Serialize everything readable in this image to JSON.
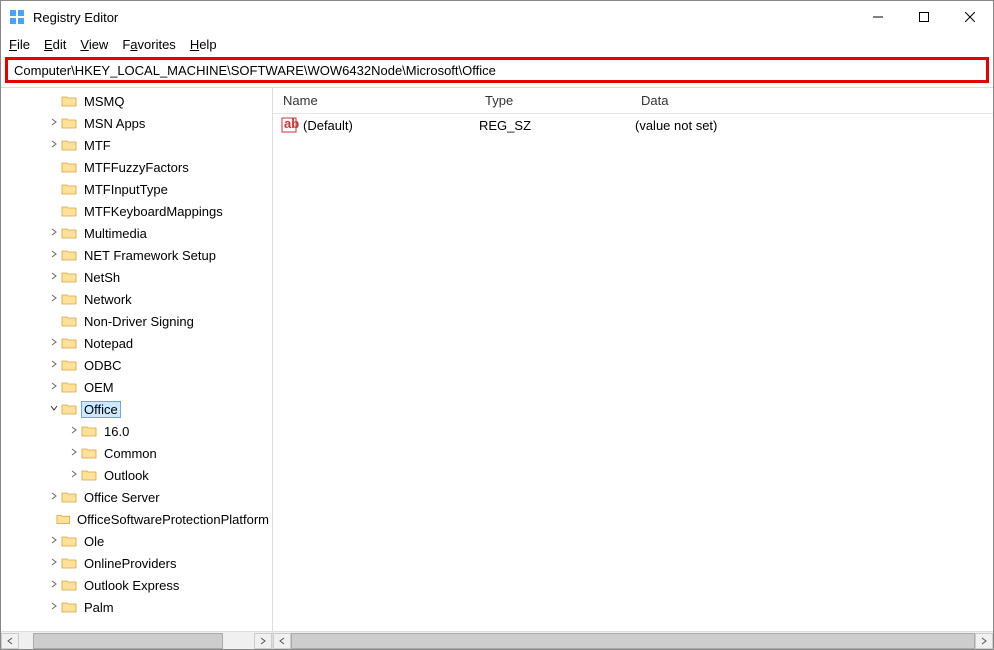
{
  "window": {
    "title": "Registry Editor"
  },
  "menu": {
    "file": "File",
    "edit": "Edit",
    "view": "View",
    "favorites": "Favorites",
    "help": "Help"
  },
  "address": {
    "path": "Computer\\HKEY_LOCAL_MACHINE\\SOFTWARE\\WOW6432Node\\Microsoft\\Office"
  },
  "columns": {
    "name": "Name",
    "type": "Type",
    "data": "Data"
  },
  "tree": [
    {
      "indent": 2,
      "exp": "",
      "label": "MSMQ"
    },
    {
      "indent": 2,
      "exp": ">",
      "label": "MSN Apps"
    },
    {
      "indent": 2,
      "exp": ">",
      "label": "MTF"
    },
    {
      "indent": 2,
      "exp": "",
      "label": "MTFFuzzyFactors"
    },
    {
      "indent": 2,
      "exp": "",
      "label": "MTFInputType"
    },
    {
      "indent": 2,
      "exp": "",
      "label": "MTFKeyboardMappings"
    },
    {
      "indent": 2,
      "exp": ">",
      "label": "Multimedia"
    },
    {
      "indent": 2,
      "exp": ">",
      "label": "NET Framework Setup"
    },
    {
      "indent": 2,
      "exp": ">",
      "label": "NetSh"
    },
    {
      "indent": 2,
      "exp": ">",
      "label": "Network"
    },
    {
      "indent": 2,
      "exp": "",
      "label": "Non-Driver Signing"
    },
    {
      "indent": 2,
      "exp": ">",
      "label": "Notepad"
    },
    {
      "indent": 2,
      "exp": ">",
      "label": "ODBC"
    },
    {
      "indent": 2,
      "exp": ">",
      "label": "OEM"
    },
    {
      "indent": 2,
      "exp": "v",
      "label": "Office",
      "selected": true
    },
    {
      "indent": 3,
      "exp": ">",
      "label": "16.0"
    },
    {
      "indent": 3,
      "exp": ">",
      "label": "Common"
    },
    {
      "indent": 3,
      "exp": ">",
      "label": "Outlook"
    },
    {
      "indent": 2,
      "exp": ">",
      "label": "Office Server"
    },
    {
      "indent": 2,
      "exp": "",
      "label": "OfficeSoftwareProtectionPlatform"
    },
    {
      "indent": 2,
      "exp": ">",
      "label": "Ole"
    },
    {
      "indent": 2,
      "exp": ">",
      "label": "OnlineProviders"
    },
    {
      "indent": 2,
      "exp": ">",
      "label": "Outlook Express"
    },
    {
      "indent": 2,
      "exp": ">",
      "label": "Palm"
    }
  ],
  "values": [
    {
      "name": "(Default)",
      "type": "REG_SZ",
      "data": "(value not set)"
    }
  ]
}
